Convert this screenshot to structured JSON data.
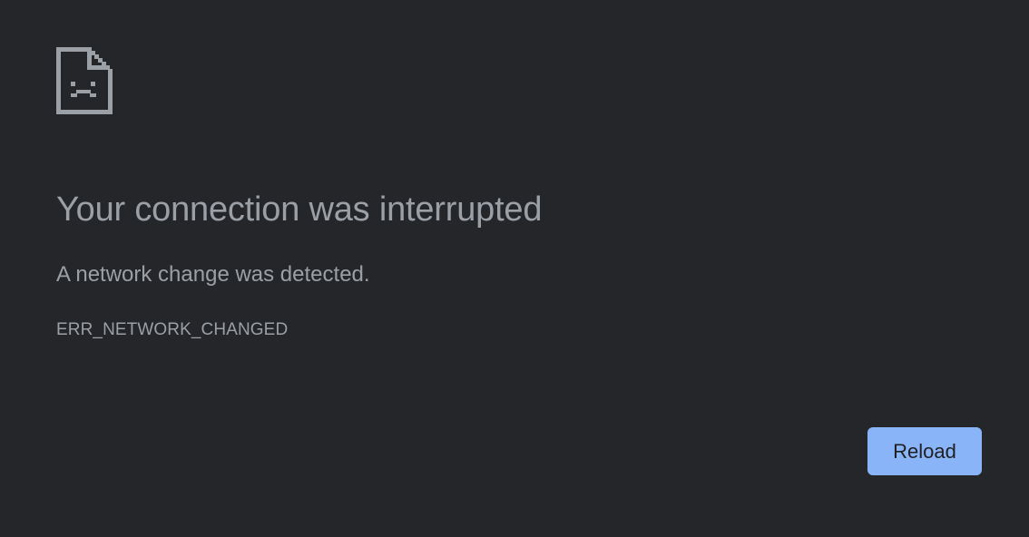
{
  "icon": {
    "name": "sad-document-icon",
    "color": "#9aa0a6"
  },
  "main": {
    "title": "Your connection was interrupted",
    "message": "A network change was detected.",
    "error_code": "ERR_NETWORK_CHANGED"
  },
  "actions": {
    "reload_label": "Reload"
  },
  "colors": {
    "background": "#25262a",
    "text": "#9aa0a6",
    "button_bg": "#8ab4f8",
    "button_text": "#202124"
  }
}
